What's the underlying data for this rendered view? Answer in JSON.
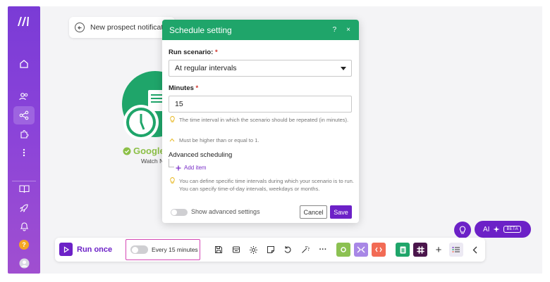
{
  "breadcrumb": {
    "title": "New prospect notification"
  },
  "module": {
    "name": "Google",
    "subtitle": "Watch N"
  },
  "dialog": {
    "title": "Schedule setting",
    "help_icon": "?",
    "close_icon": "×",
    "run_scenario_label": "Run scenario:",
    "run_scenario_required": "*",
    "run_scenario_value": "At regular intervals",
    "minutes_label": "Minutes",
    "minutes_required": "*",
    "minutes_value": "15",
    "hint_interval": "The time interval in which the scenario should be repeated (in minutes).",
    "hint_min": "Must be higher than or equal to 1.",
    "advanced_title": "Advanced scheduling",
    "add_item": "Add item",
    "hint_advanced": "You can define specific time intervals during which your scenario is to run. You can specify time-of-day intervals, weekdays or months.",
    "show_advanced": "Show advanced settings",
    "cancel": "Cancel",
    "save": "Save"
  },
  "toolbar": {
    "run_once": "Run once",
    "schedule": "Every 15 minutes",
    "more": "···",
    "plus": "+"
  },
  "ai": {
    "label": "AI",
    "badge": "BETA"
  },
  "sidebar": {
    "help": "?"
  },
  "colors": {
    "brand": "#6c21c7",
    "header_green": "#1fa56a",
    "highlight": "#d447b5"
  }
}
